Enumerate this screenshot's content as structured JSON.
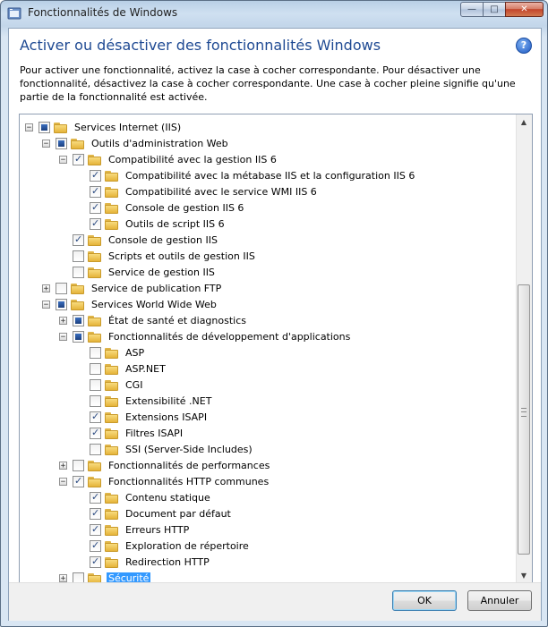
{
  "window": {
    "title": "Fonctionnalités de Windows",
    "minimize_label": "—",
    "maximize_label": "□",
    "close_label": "✕"
  },
  "heading": "Activer ou désactiver des fonctionnalités Windows",
  "help_label": "?",
  "description": "Pour activer une fonctionnalité, activez la case à cocher correspondante. Pour désactiver une fonctionnalité, désactivez la case à cocher correspondante. Une case à cocher pleine signifie qu'une partie de la fonctionnalité est activée.",
  "tree": [
    {
      "label": "Services Internet (IIS)",
      "depth": 0,
      "expander": "−",
      "state": "partial"
    },
    {
      "label": "Outils d'administration Web",
      "depth": 1,
      "expander": "−",
      "state": "partial"
    },
    {
      "label": "Compatibilité avec la gestion IIS 6",
      "depth": 2,
      "expander": "−",
      "state": "checked"
    },
    {
      "label": "Compatibilité avec la métabase IIS et la configuration IIS 6",
      "depth": 3,
      "expander": "",
      "state": "checked"
    },
    {
      "label": "Compatibilité avec le service WMI IIS 6",
      "depth": 3,
      "expander": "",
      "state": "checked"
    },
    {
      "label": "Console de gestion IIS 6",
      "depth": 3,
      "expander": "",
      "state": "checked"
    },
    {
      "label": "Outils de script IIS 6",
      "depth": 3,
      "expander": "",
      "state": "checked"
    },
    {
      "label": "Console de gestion IIS",
      "depth": 2,
      "expander": "",
      "state": "checked"
    },
    {
      "label": "Scripts et outils de gestion IIS",
      "depth": 2,
      "expander": "",
      "state": "unchecked"
    },
    {
      "label": "Service de gestion IIS",
      "depth": 2,
      "expander": "",
      "state": "unchecked"
    },
    {
      "label": "Service de publication FTP",
      "depth": 1,
      "expander": "+",
      "state": "unchecked"
    },
    {
      "label": "Services World Wide Web",
      "depth": 1,
      "expander": "−",
      "state": "partial"
    },
    {
      "label": "État de santé et diagnostics",
      "depth": 2,
      "expander": "+",
      "state": "partial"
    },
    {
      "label": "Fonctionnalités de développement d'applications",
      "depth": 2,
      "expander": "−",
      "state": "partial"
    },
    {
      "label": "ASP",
      "depth": 3,
      "expander": "",
      "state": "unchecked"
    },
    {
      "label": "ASP.NET",
      "depth": 3,
      "expander": "",
      "state": "unchecked"
    },
    {
      "label": "CGI",
      "depth": 3,
      "expander": "",
      "state": "unchecked"
    },
    {
      "label": "Extensibilité .NET",
      "depth": 3,
      "expander": "",
      "state": "unchecked"
    },
    {
      "label": "Extensions ISAPI",
      "depth": 3,
      "expander": "",
      "state": "checked"
    },
    {
      "label": "Filtres ISAPI",
      "depth": 3,
      "expander": "",
      "state": "checked"
    },
    {
      "label": "SSI (Server-Side Includes)",
      "depth": 3,
      "expander": "",
      "state": "unchecked"
    },
    {
      "label": "Fonctionnalités de performances",
      "depth": 2,
      "expander": "+",
      "state": "unchecked"
    },
    {
      "label": "Fonctionnalités HTTP communes",
      "depth": 2,
      "expander": "−",
      "state": "checked"
    },
    {
      "label": "Contenu statique",
      "depth": 3,
      "expander": "",
      "state": "checked"
    },
    {
      "label": "Document par défaut",
      "depth": 3,
      "expander": "",
      "state": "checked"
    },
    {
      "label": "Erreurs HTTP",
      "depth": 3,
      "expander": "",
      "state": "checked"
    },
    {
      "label": "Exploration de répertoire",
      "depth": 3,
      "expander": "",
      "state": "checked"
    },
    {
      "label": "Redirection HTTP",
      "depth": 3,
      "expander": "",
      "state": "checked"
    },
    {
      "label": "Sécurité",
      "depth": 2,
      "expander": "+",
      "state": "unchecked",
      "selected": true
    }
  ],
  "scrollbar": {
    "up_arrow": "▲",
    "down_arrow": "▼"
  },
  "buttons": {
    "ok": "OK",
    "cancel": "Annuler"
  }
}
